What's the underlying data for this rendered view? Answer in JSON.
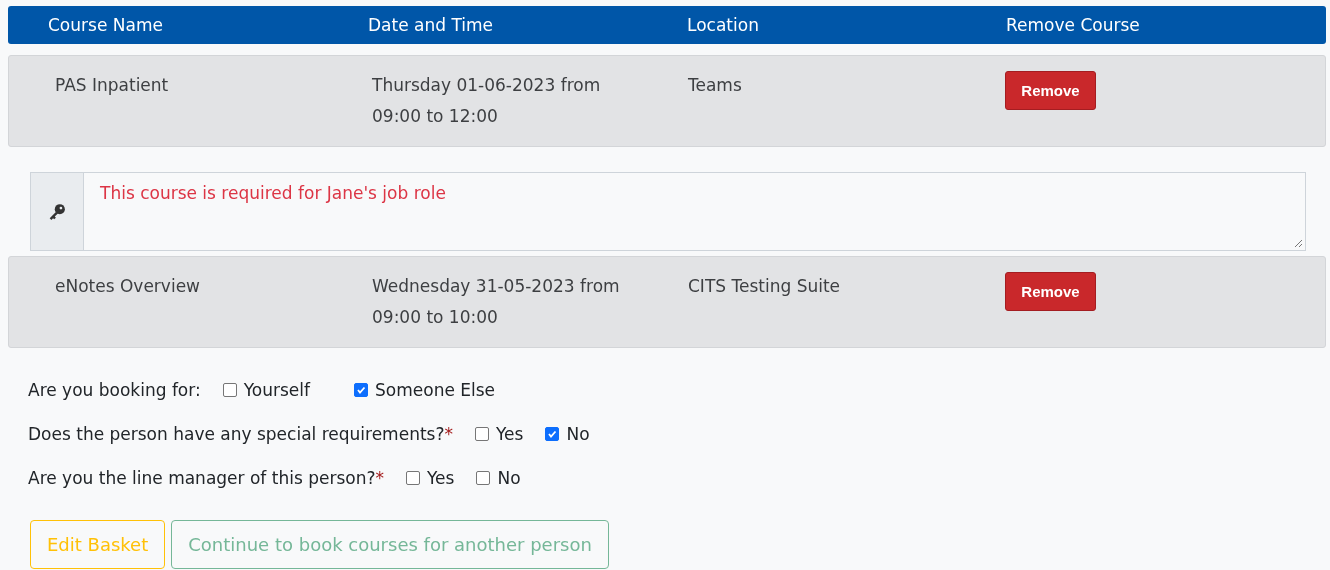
{
  "table": {
    "columns": [
      "Course Name",
      "Date and Time",
      "Location",
      "Remove Course"
    ],
    "rows": [
      {
        "course": "PAS Inpatient",
        "date": "Thursday 01-06-2023 from",
        "time": "09:00 to 12:00",
        "location": "Teams",
        "button": "Remove",
        "note": "This course is required for Jane's job role"
      },
      {
        "course": "eNotes Overview",
        "date": "Wednesday 31-05-2023 from",
        "time": "09:00 to 10:00",
        "location": "CITS Testing Suite",
        "button": "Remove"
      }
    ]
  },
  "questions": [
    {
      "label": "Are you booking for:",
      "options": [
        {
          "label": "Yourself",
          "checked": false
        },
        {
          "label": "Someone Else",
          "checked": true
        }
      ]
    },
    {
      "label": "Does the person have any special requirements?",
      "marker": "*",
      "options": [
        {
          "label": "Yes",
          "checked": false
        },
        {
          "label": "No",
          "checked": true
        }
      ]
    },
    {
      "label": "Are you the line manager of this person?",
      "marker": "*",
      "options": [
        {
          "label": "Yes",
          "checked": false
        },
        {
          "label": "No",
          "checked": false
        }
      ]
    }
  ],
  "buttons": [
    {
      "label": "Edit Basket",
      "kind": "warning"
    },
    {
      "label": "Continue to book courses for another person",
      "kind": "success"
    }
  ]
}
